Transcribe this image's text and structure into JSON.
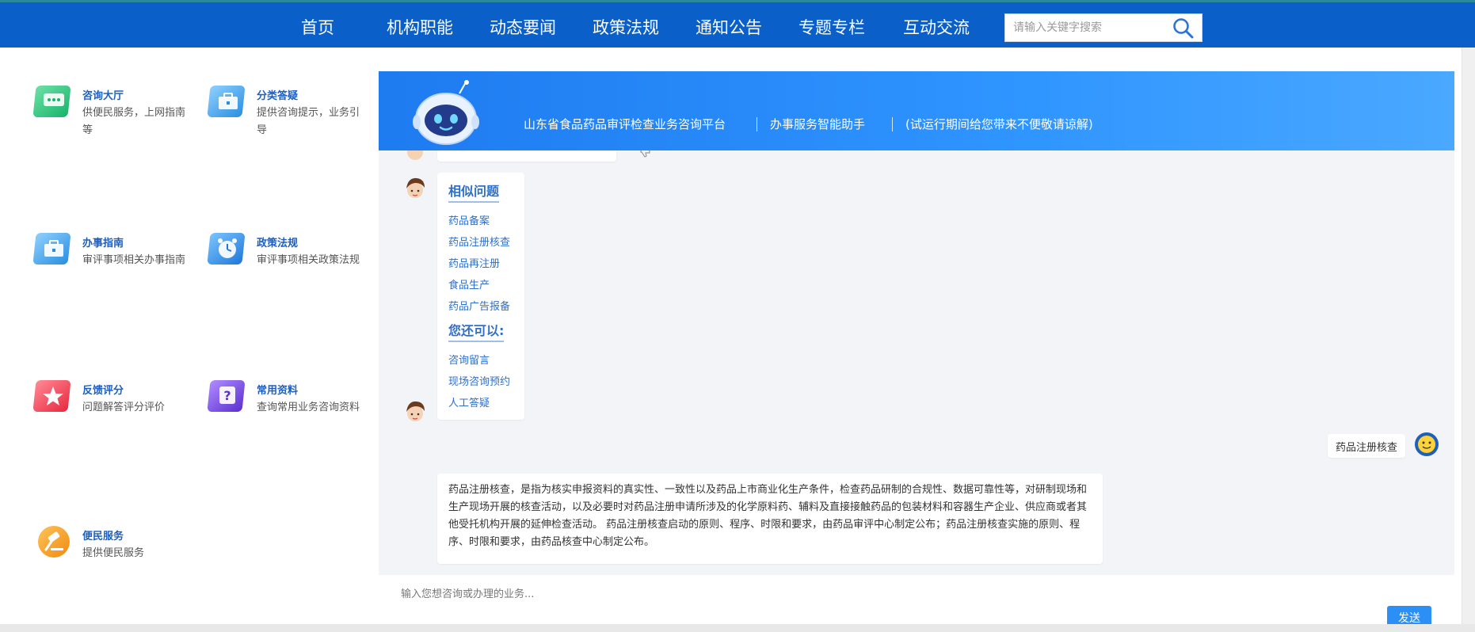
{
  "nav": {
    "items": [
      "首页",
      "机构职能",
      "动态要闻",
      "政策法规",
      "通知公告",
      "专题专栏",
      "互动交流"
    ],
    "search_placeholder": "请输入关键字搜索"
  },
  "services": [
    {
      "title": "咨询大厅",
      "desc": "供便民服务，上网指南等",
      "icon": "chat-window-icon",
      "color": "#22c07a"
    },
    {
      "title": "分类答疑",
      "desc": "提供咨询提示，业务引导",
      "icon": "briefcase-icon",
      "color": "#3aa4e8"
    },
    {
      "title": "办事指南",
      "desc": "审评事项相关办事指南",
      "icon": "briefcase-icon",
      "color": "#3aa4e8"
    },
    {
      "title": "政策法规",
      "desc": "审评事项相关政策法规",
      "icon": "alarm-clock-icon",
      "color": "#2a86e0"
    },
    {
      "title": "反馈评分",
      "desc": "问题解答评分评价",
      "icon": "star-icon",
      "color": "#f04858"
    },
    {
      "title": "常用资料",
      "desc": "查询常用业务咨询资料",
      "icon": "question-doc-icon",
      "color": "#7a48e0"
    },
    {
      "title": "便民服务",
      "desc": "提供便民服务",
      "icon": "hammer-icon",
      "color": "#f5a020"
    }
  ],
  "chat": {
    "header": {
      "platform": "山东省食品药品审评检查业务咨询平台",
      "assistant": "办事服务智能助手",
      "notice": "(试运行期间给您带来不便敬请谅解)"
    },
    "similar": {
      "title": "相似问题",
      "links": [
        "药品备案",
        "药品注册核查",
        "药品再注册",
        "食品生产",
        "药品广告报备"
      ]
    },
    "also": {
      "title": "您还可以:",
      "links": [
        "咨询留言",
        "现场咨询预约",
        "人工答疑"
      ]
    },
    "user_message": "药品注册核查",
    "answer": "药品注册核查，是指为核实申报资料的真实性、一致性以及药品上市商业化生产条件，检查药品研制的合规性、数据可靠性等，对研制现场和生产现场开展的核查活动，以及必要时对药品注册申请所涉及的化学原料药、辅料及直接接触药品的包装材料和容器生产企业、供应商或者其他受托机构开展的延伸检查活动。 药品注册核查启动的原则、程序、时限和要求，由药品审评中心制定公布；药品注册核查实施的原则、程序、时限和要求，由药品核查中心制定公布。",
    "input_placeholder": "输入您想咨询或办理的业务...",
    "send_label": "发送"
  }
}
